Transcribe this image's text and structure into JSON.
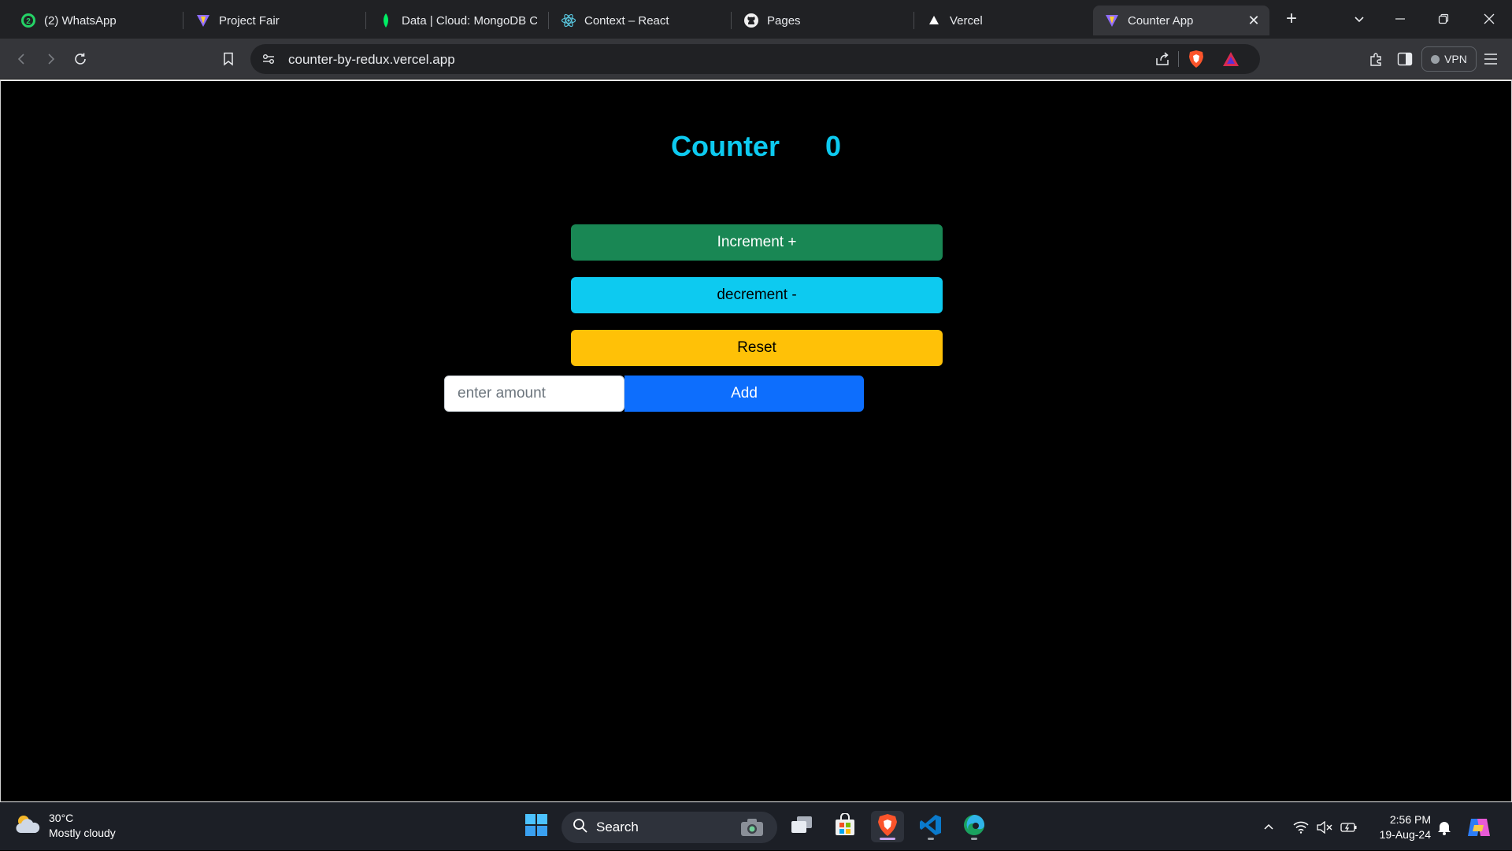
{
  "browser": {
    "tabs": [
      {
        "label": "(2) WhatsApp",
        "icon": "whatsapp-icon"
      },
      {
        "label": "Project Fair",
        "icon": "vite-icon"
      },
      {
        "label": "Data | Cloud: MongoDB C",
        "icon": "mongodb-leaf-icon"
      },
      {
        "label": "Context – React",
        "icon": "react-icon"
      },
      {
        "label": "Pages",
        "icon": "github-icon"
      },
      {
        "label": "Vercel",
        "icon": "vercel-icon"
      },
      {
        "label": "Counter App",
        "icon": "vite-icon",
        "active": true
      }
    ],
    "url": "counter-by-redux.vercel.app",
    "vpn_label": "VPN"
  },
  "app": {
    "title": "Counter",
    "count": "0",
    "increment_label": "Increment +",
    "decrement_label": "decrement -",
    "reset_label": "Reset",
    "amount_placeholder": "enter amount",
    "add_label": "Add"
  },
  "taskbar": {
    "weather_temp": "30°C",
    "weather_desc": "Mostly cloudy",
    "search_label": "Search",
    "time": "2:56 PM",
    "date": "19-Aug-24"
  },
  "colors": {
    "counter_text": "#0dcaf0",
    "increment": "#198754",
    "decrement": "#0dcaf0",
    "reset": "#ffc107",
    "add": "#0d6efd"
  }
}
